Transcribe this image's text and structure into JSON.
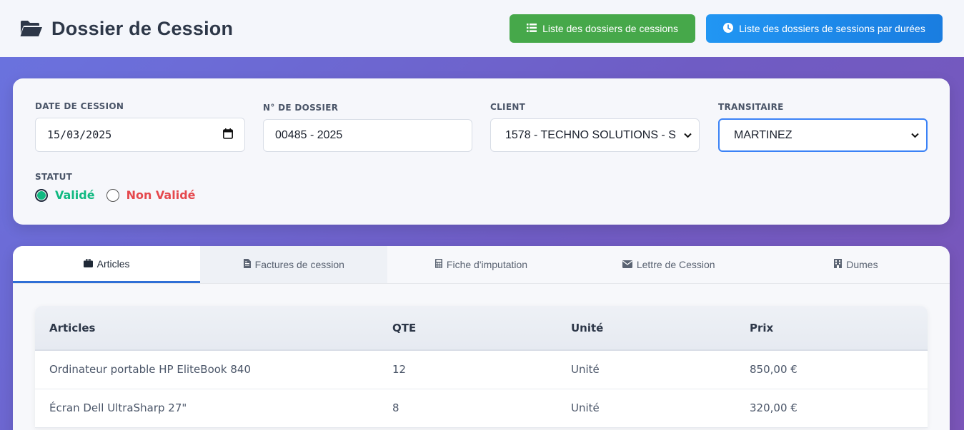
{
  "header": {
    "title": "Dossier de Cession",
    "title_icon": "folder-open-icon",
    "buttons": [
      {
        "label": "Liste des dossiers de cessions",
        "icon": "list-icon",
        "color": "#46a84a"
      },
      {
        "label": "Liste des dossiers de sessions par durées",
        "icon": "clock-icon",
        "color": "#2196f3"
      }
    ]
  },
  "form": {
    "date_label": "DATE DE CESSION",
    "date_value": "15/03/2025",
    "dossier_label": "N° DE DOSSIER",
    "dossier_value": "00485 - 2025",
    "client_label": "CLIENT",
    "client_value": "1578 - TECHNO SOLUTIONS - S",
    "transitaire_label": "TRANSITAIRE",
    "transitaire_value": "MARTINEZ",
    "statut_label": "STATUT",
    "statut_options": [
      {
        "label": "Validé",
        "checked": true
      },
      {
        "label": "Non Validé",
        "checked": false
      }
    ]
  },
  "tabs": [
    {
      "label": "Articles",
      "icon": "briefcase-icon",
      "active": true
    },
    {
      "label": "Factures de cession",
      "icon": "file-text-icon",
      "active": false
    },
    {
      "label": "Fiche d'imputation",
      "icon": "calculator-icon",
      "active": false
    },
    {
      "label": "Lettre de Cession",
      "icon": "envelope-icon",
      "active": false
    },
    {
      "label": "Dumes",
      "icon": "building-icon",
      "active": false
    }
  ],
  "table": {
    "columns": [
      "Articles",
      "QTE",
      "Unité",
      "Prix"
    ],
    "rows": [
      [
        "Ordinateur portable HP EliteBook 840",
        "12",
        "Unité",
        "850,00 €"
      ],
      [
        "Écran Dell UltraSharp 27\"",
        "8",
        "Unité",
        "320,00 €"
      ]
    ]
  }
}
